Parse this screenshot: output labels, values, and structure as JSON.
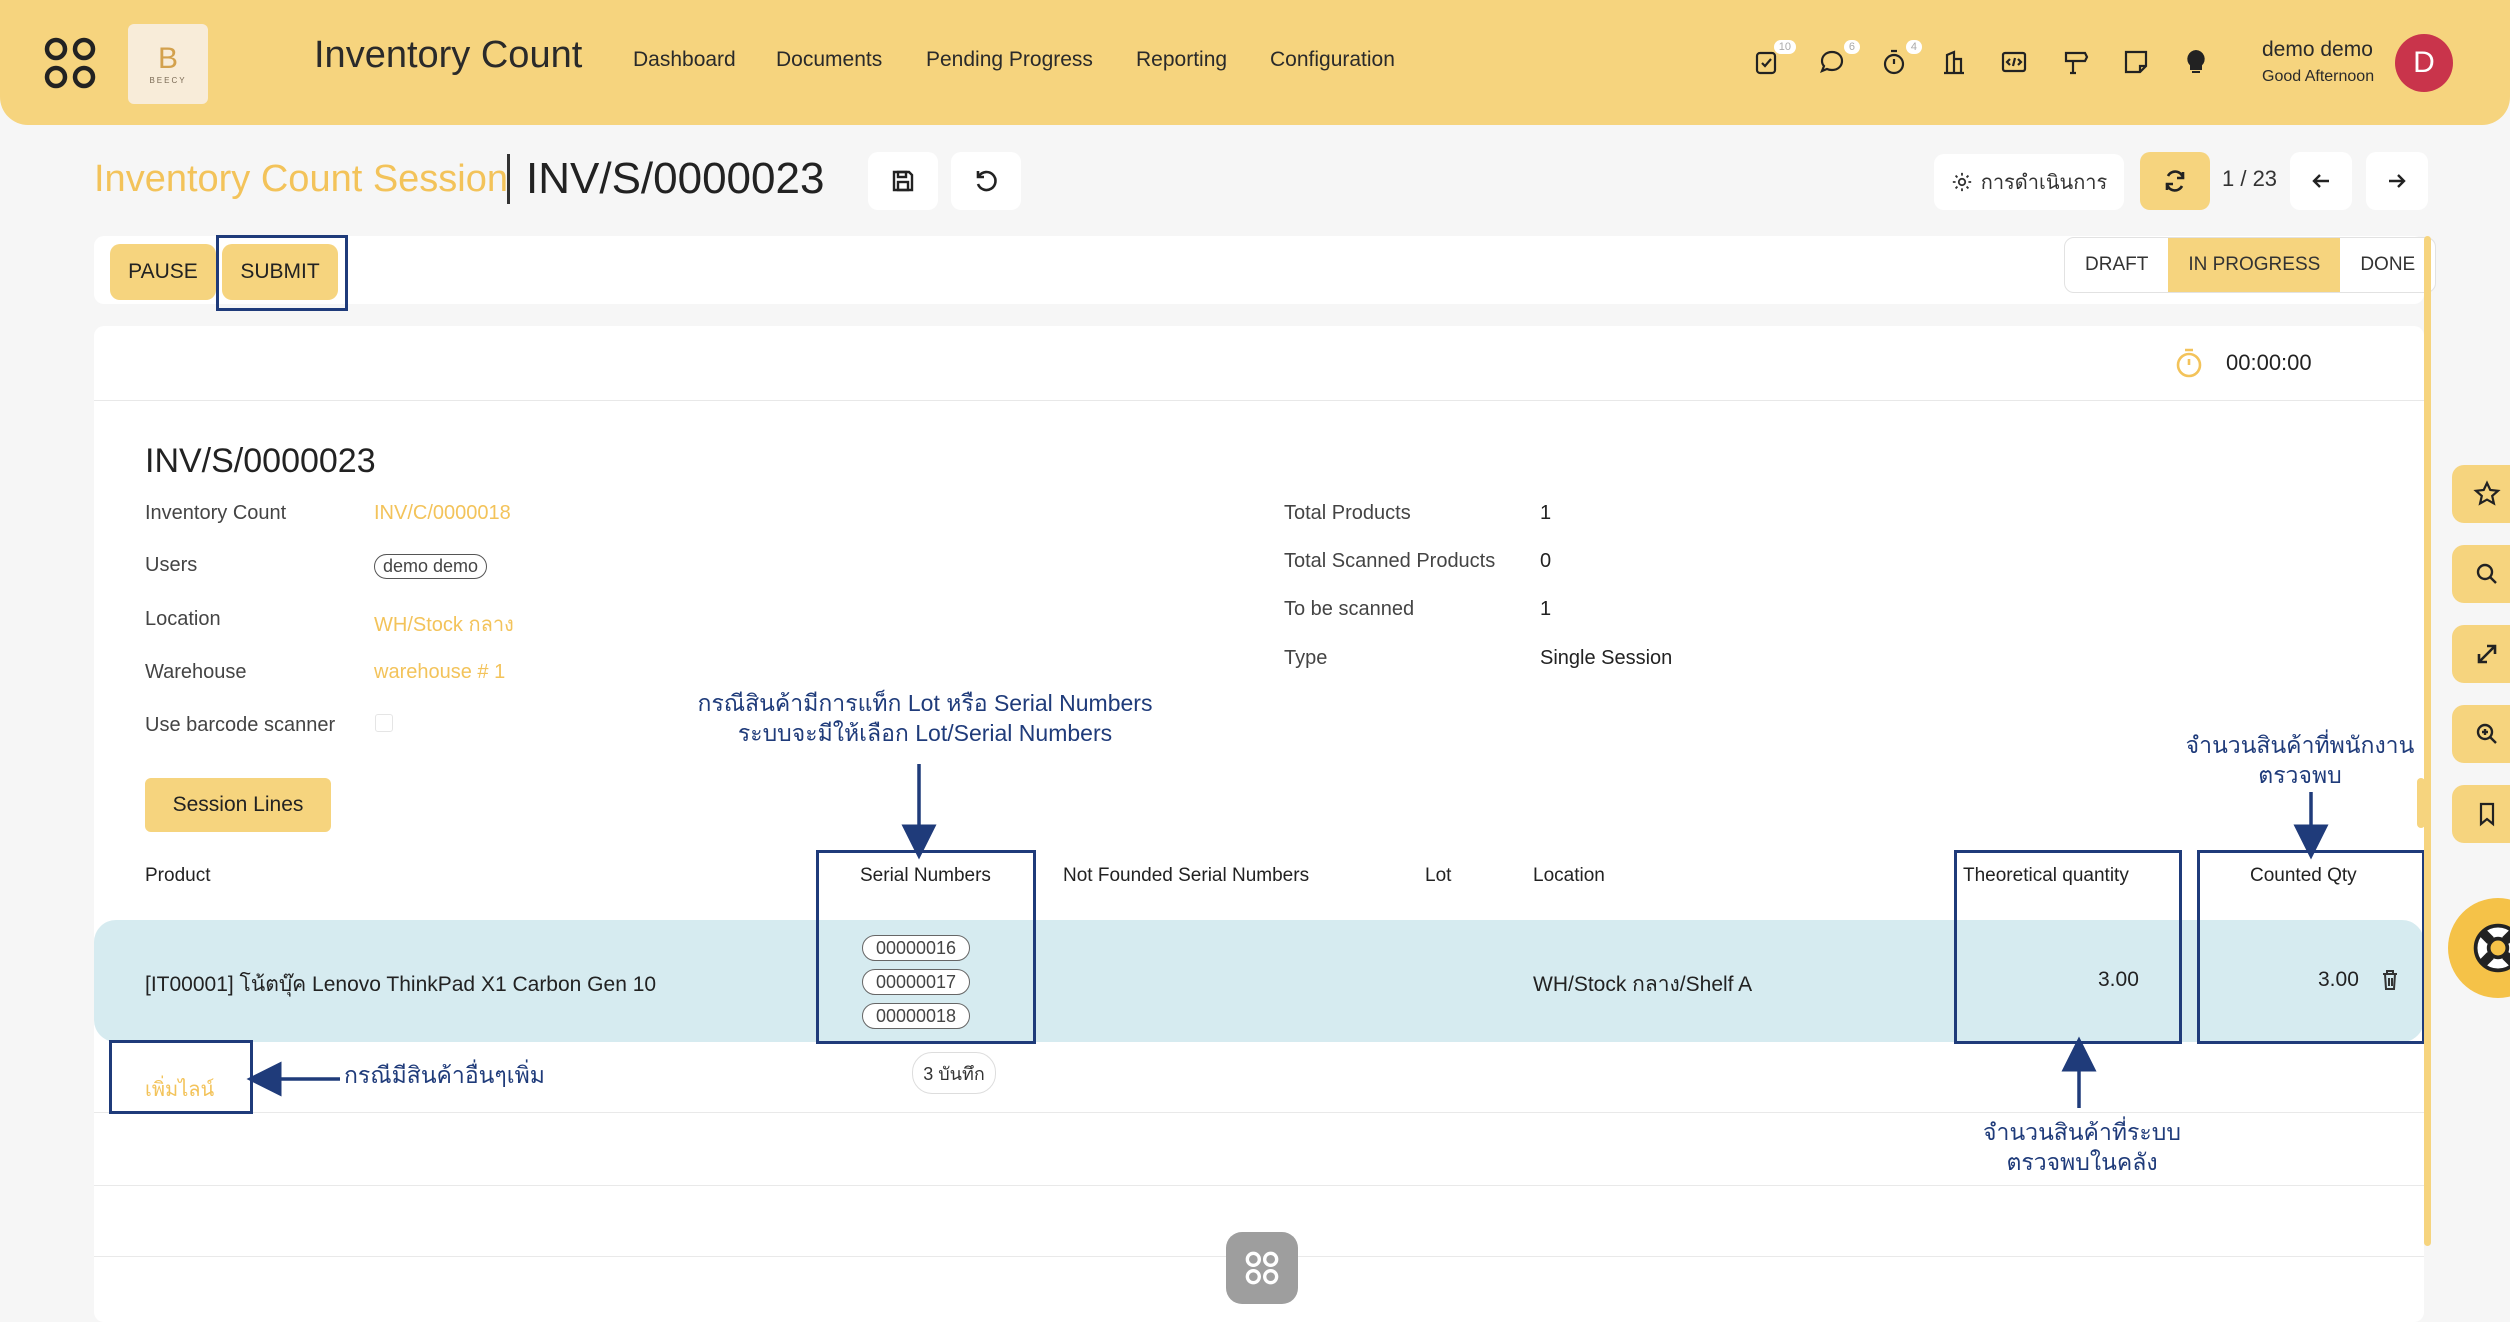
{
  "topbar": {
    "app_title": "Inventory Count",
    "nav": [
      "Dashboard",
      "Documents",
      "Pending Progress",
      "Reporting",
      "Configuration"
    ],
    "badges": {
      "activities": "10",
      "messages": "6",
      "timer": "4"
    },
    "user_name": "demo demo",
    "greeting": "Good Afternoon",
    "avatar_letter": "D",
    "logo_letter": "B",
    "logo_text": "BEECY"
  },
  "breadcrumb": {
    "parent": "Inventory Count Session",
    "current": "INV/S/0000023"
  },
  "controls": {
    "action_label": "การดำเนินการ",
    "pager": "1 / 23"
  },
  "statusbar": {
    "pause_label": "PAUSE",
    "submit_label": "SUBMIT",
    "stages": [
      "DRAFT",
      "IN PROGRESS",
      "DONE"
    ],
    "active_stage": "IN PROGRESS"
  },
  "timer": "00:00:00",
  "record": {
    "title": "INV/S/0000023",
    "left_fields": [
      {
        "label": "Inventory Count",
        "value": "INV/C/0000018"
      },
      {
        "label": "Users",
        "value": "demo demo"
      },
      {
        "label": "Location",
        "value": "WH/Stock กลาง"
      },
      {
        "label": "Warehouse",
        "value": "warehouse # 1"
      },
      {
        "label": "Use barcode scanner",
        "value": ""
      }
    ],
    "right_fields": [
      {
        "label": "Total Products",
        "value": "1"
      },
      {
        "label": "Total Scanned Products",
        "value": "0"
      },
      {
        "label": "To be scanned",
        "value": "1"
      },
      {
        "label": "Type",
        "value": "Single Session"
      }
    ]
  },
  "tab": {
    "label": "Session Lines"
  },
  "table": {
    "headers": [
      "Product",
      "Serial Numbers",
      "Not Founded Serial Numbers",
      "Lot",
      "Location",
      "Theoretical quantity",
      "Counted Qty"
    ],
    "row": {
      "product": "[IT00001] โน้ตบุ๊ค Lenovo ThinkPad X1 Carbon Gen 10",
      "serials": [
        "00000016",
        "00000017",
        "00000018"
      ],
      "location": "WH/Stock กลาง/Shelf A",
      "theoretical_qty": "3.00",
      "counted_qty": "3.00"
    },
    "add_line": "เพิ่มไลน์",
    "serial_count": "3 บันทึก"
  },
  "annotations": {
    "serial_note": [
      "กรณีสินค้ามีการแท็ก Lot หรือ Serial Numbers",
      "ระบบจะมีให้เลือก Lot/Serial Numbers"
    ],
    "counted_note": [
      "จำนวนสินค้าที่พนักงาน",
      "ตรวจพบ"
    ],
    "add_note": "กรณีมีสินค้าอื่นๆเพิ่ม",
    "theoretical_note": [
      "จำนวนสินค้าที่ระบบ",
      "ตรวจพบในคลัง"
    ]
  },
  "colors": {
    "accent": "#f6d47e",
    "link": "#f3c35a",
    "annotation": "#1f3b7a",
    "row": "#d6ebf0",
    "avatar": "#c9344b"
  }
}
